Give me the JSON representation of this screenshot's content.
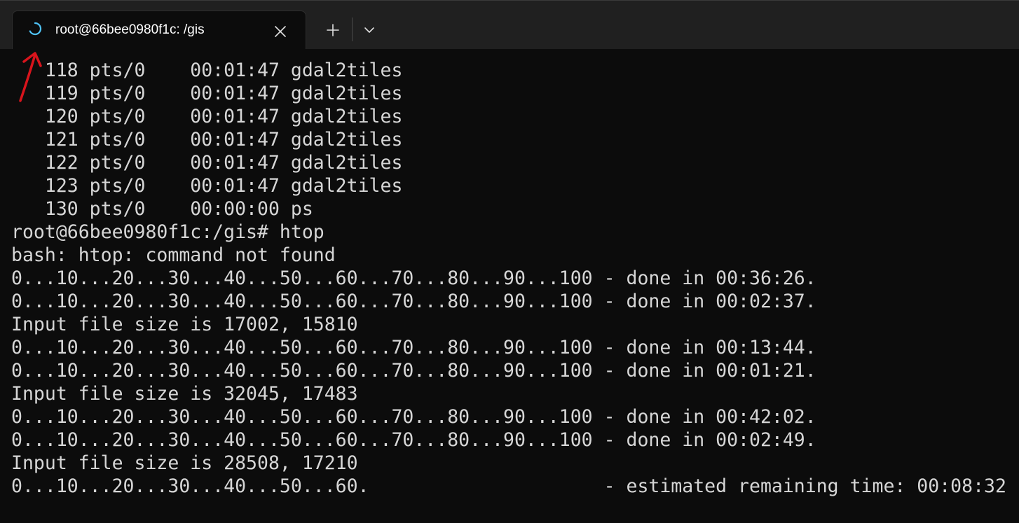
{
  "tab": {
    "title": "root@66bee0980f1c: /gis",
    "status_icon": "loading-spinner-icon",
    "close_icon": "close-icon"
  },
  "titlebar": {
    "new_tab_icon": "plus-icon",
    "dropdown_icon": "chevron-down-icon"
  },
  "annotation": {
    "icon": "red-arrow-annotation",
    "color": "#d8141c"
  },
  "terminal": {
    "lines": [
      "   118 pts/0    00:01:47 gdal2tiles",
      "   119 pts/0    00:01:47 gdal2tiles",
      "   120 pts/0    00:01:47 gdal2tiles",
      "   121 pts/0    00:01:47 gdal2tiles",
      "   122 pts/0    00:01:47 gdal2tiles",
      "   123 pts/0    00:01:47 gdal2tiles",
      "   130 pts/0    00:00:00 ps",
      "root@66bee0980f1c:/gis# htop",
      "bash: htop: command not found",
      "0...10...20...30...40...50...60...70...80...90...100 - done in 00:36:26.",
      "0...10...20...30...40...50...60...70...80...90...100 - done in 00:02:37.",
      "Input file size is 17002, 15810",
      "0...10...20...30...40...50...60...70...80...90...100 - done in 00:13:44.",
      "0...10...20...30...40...50...60...70...80...90...100 - done in 00:01:21.",
      "Input file size is 32045, 17483",
      "0...10...20...30...40...50...60...70...80...90...100 - done in 00:42:02.",
      "0...10...20...30...40...50...60...70...80...90...100 - done in 00:02:49.",
      "Input file size is 28508, 17210",
      "0...10...20...30...40...50...60.                     - estimated remaining time: 00:08:32"
    ]
  },
  "colors": {
    "terminal_bg": "#0c0c0c",
    "terminal_fg": "#d6d6d6",
    "titlebar_bg": "#202020",
    "spinner": "#4fc3f7"
  }
}
